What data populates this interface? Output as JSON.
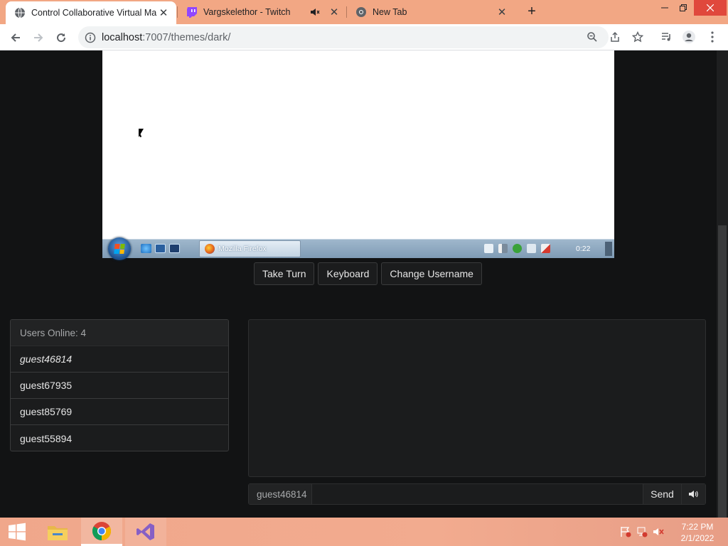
{
  "browser": {
    "tabs": [
      {
        "title": "Control Collaborative Virtual Ma",
        "favicon": "globe-icon",
        "active": true
      },
      {
        "title": "Vargskelethor - Twitch",
        "favicon": "twitch-icon",
        "muted": true
      },
      {
        "title": "New Tab",
        "favicon": "chrome-icon"
      }
    ],
    "new_tab_label": "+",
    "url_host": "localhost",
    "url_rest": ":7007/themes/dark/",
    "colors": {
      "tab_strip": "#f2a784",
      "close_hover": "#e0483c"
    }
  },
  "vm": {
    "taskbar_item": "Mozilla Firefox",
    "clock": "0:22"
  },
  "controls": {
    "take_turn": "Take Turn",
    "keyboard": "Keyboard",
    "change_username": "Change Username"
  },
  "users": {
    "heading": "Users Online: 4",
    "list": [
      "guest46814",
      "guest67935",
      "guest85769",
      "guest55894"
    ]
  },
  "chat": {
    "username": "guest46814",
    "input_value": "",
    "send_label": "Send",
    "voice_icon": "speaker-icon"
  },
  "os": {
    "time": "7:22 PM",
    "date": "2/1/2022",
    "apps": [
      "file-explorer-icon",
      "chrome-icon",
      "visual-studio-icon"
    ]
  }
}
